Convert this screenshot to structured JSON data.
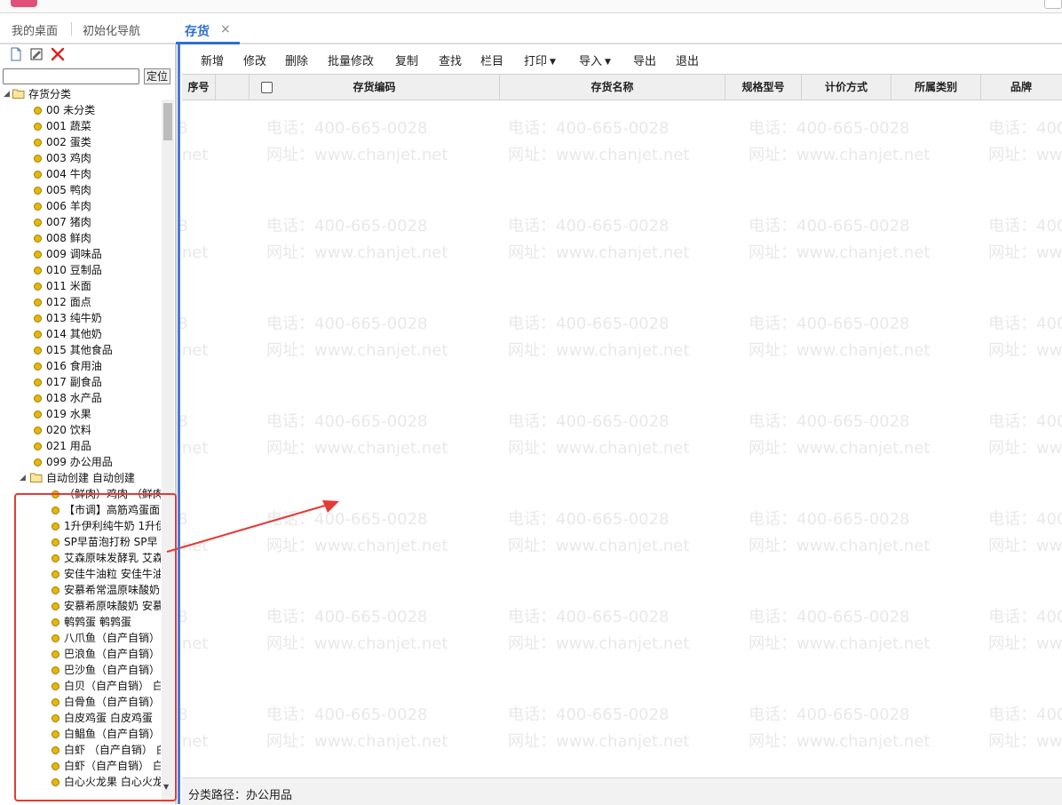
{
  "nav": {
    "desktop_tab": "我的桌面",
    "init_nav_tab": "初始化导航",
    "active_tab": "存货",
    "close_symbol": "×"
  },
  "tree_panel": {
    "locate_button": "定位",
    "search_value": "",
    "root_label": "存货分类",
    "categories": [
      "00 未分类",
      "001 蔬菜",
      "002 蛋类",
      "003 鸡肉",
      "004 牛肉",
      "005 鸭肉",
      "006 羊肉",
      "007 猪肉",
      "008 鲜肉",
      "009 调味品",
      "010 豆制品",
      "011 米面",
      "012 面点",
      "013 纯牛奶",
      "014 其他奶",
      "015 其他食品",
      "016 食用油",
      "017 副食品",
      "018 水产品",
      "019 水果",
      "020 饮料",
      "021 用品",
      "099 办公用品"
    ],
    "auto_group_label": "自动创建 自动创建",
    "auto_items": [
      "（鲜肉）鸡肉 （鲜肉",
      "【市调】高筋鸡蛋面",
      "1升伊利纯牛奶 1升伊",
      "SP早苗泡打粉 SP早",
      "艾森原味发酵乳 艾森",
      "安佳牛油粒 安佳牛油",
      "安慕希常温原味酸奶",
      "安慕希原味酸奶 安慕",
      "鹌鹑蛋 鹌鹑蛋",
      "八爪鱼（自产自销）",
      "巴浪鱼（自产自销）",
      "巴沙鱼（自产自销）",
      "白贝（自产自销） 白",
      "白骨鱼（自产自销）",
      "白皮鸡蛋 白皮鸡蛋",
      "白鲳鱼（自产自销）",
      "白虾 （自产自销） 白",
      "白虾（自产自销） 白",
      "白心火龙果 白心火龙"
    ]
  },
  "toolbar": {
    "add": "新增",
    "edit": "修改",
    "delete": "删除",
    "batch_edit": "批量修改",
    "copy": "复制",
    "find": "查找",
    "columns": "栏目",
    "print": "打印",
    "import": "导入",
    "export": "导出",
    "exit": "退出"
  },
  "grid": {
    "columns": [
      "序号",
      "存货编码",
      "存货名称",
      "规格型号",
      "计价方式",
      "所属类别",
      "品牌"
    ]
  },
  "status": {
    "path_text": "分类路径：办公用品"
  },
  "watermark": {
    "phone": "电话：400-665-0028",
    "site": "网址：www.chanjet.net"
  },
  "colors": {
    "accent": "#2f6fd1",
    "annotation": "#e53935",
    "leaf_dot": "#e6b800"
  }
}
